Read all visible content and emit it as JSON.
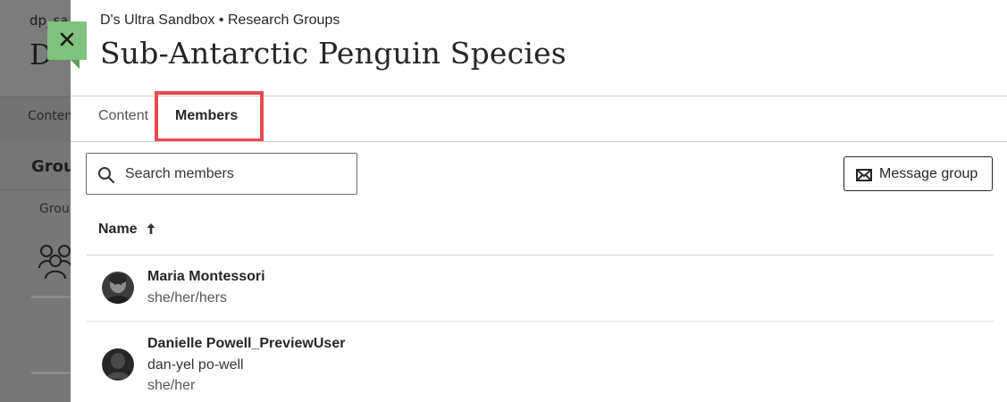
{
  "background": {
    "course_id": "dp_sa",
    "course_letter": "D",
    "nav_label": "Conten",
    "section_title": "Grou",
    "column_label": "Grou"
  },
  "panel": {
    "breadcrumb": "D's Ultra Sandbox • Research Groups",
    "title": "Sub-Antarctic Penguin Species",
    "tabs": [
      {
        "label": "Content",
        "active": false
      },
      {
        "label": "Members",
        "active": true
      }
    ],
    "search": {
      "placeholder": "Search members",
      "value": ""
    },
    "message_button": "Message group",
    "table": {
      "column_name": "Name",
      "sort": "ascending",
      "members": [
        {
          "name": "Maria Montessori",
          "pronouns": "she/her/hers",
          "pronunciation": ""
        },
        {
          "name": "Danielle Powell_PreviewUser",
          "pronunciation": "dan-yel po-well",
          "pronouns": "she/her"
        }
      ]
    }
  },
  "colors": {
    "close_button": "#7fc37c",
    "highlight": "#ea4a4f",
    "text": "#262626"
  },
  "icons": {
    "close": "close-icon",
    "search": "search-icon",
    "message": "envelope-icon",
    "sort": "arrow-up-icon",
    "group": "group-people-icon"
  }
}
